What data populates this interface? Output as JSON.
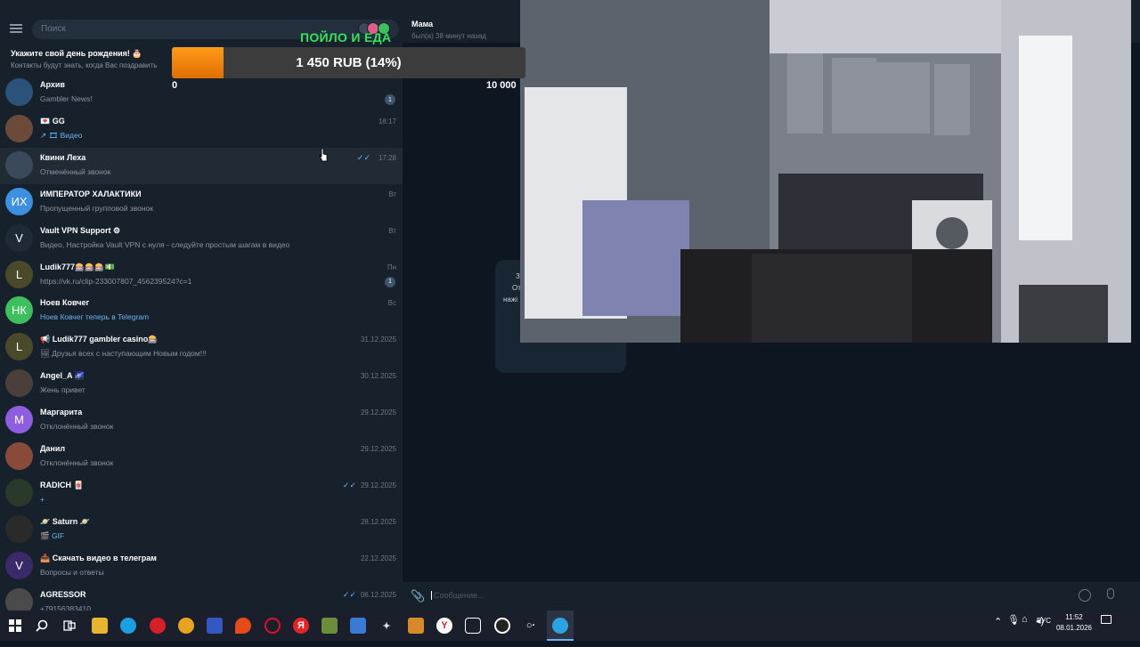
{
  "sidebar": {
    "search_placeholder": "Поиск",
    "birthday_title": "Укажите свой день рождения! 🎂",
    "birthday_sub": "Контакты будут знать, когда Вас поздравить",
    "chats": [
      {
        "name": "Архив",
        "preview": "Gambler News!",
        "time": "",
        "badge": "1",
        "avatar_text": "",
        "avatar_color": "#2b5278"
      },
      {
        "name": "💌 GG",
        "preview": "↗ 🎞 Видео",
        "time": "18:17",
        "badge": "",
        "avatar_text": "",
        "avatar_color": "#6b4a3a"
      },
      {
        "name": "Квини Леха",
        "preview": "Отменённый звонок",
        "time": "17:28",
        "badge": "",
        "avatar_text": "",
        "avatar_color": "#3a4a5a",
        "checked": true
      },
      {
        "name": "ИМПЕРАТОР ХАЛАКТИКИ",
        "preview": "Пропущенный групповой звонок",
        "time": "Вт",
        "badge": "",
        "avatar_text": "ИХ",
        "avatar_color": "#3d8fe0"
      },
      {
        "name": "Vault VPN Support ⚙",
        "preview": "Видео, Настройка Vault VPN с нуля - следуйте простым шагам в видео",
        "time": "Вт",
        "badge": "",
        "avatar_text": "V",
        "avatar_color": "#1e2a38"
      },
      {
        "name": "Ludik777🎰🎰🎰💵",
        "preview": "https://vk.ru/clip-233007807_456239524?c=1",
        "time": "Пн",
        "badge": "1",
        "avatar_text": "L",
        "avatar_color": "#4a4a2a"
      },
      {
        "name": "Ноев Ковчег",
        "preview": "Ноев Ковчег теперь в Telegram",
        "time": "Вс",
        "badge": "",
        "avatar_text": "НК",
        "avatar_color": "#3cbf5c"
      },
      {
        "name": "📢 Ludik777 gambler casino🎰",
        "preview": "🖼 Друзья всех с наступающим Новым годом!!!",
        "time": "31.12.2025",
        "badge": "",
        "avatar_text": "L",
        "avatar_color": "#4a4a2a"
      },
      {
        "name": "Angel_A 🌌",
        "preview": "Жень привет",
        "time": "30.12.2025",
        "badge": "",
        "avatar_text": "",
        "avatar_color": "#4a3f3a"
      },
      {
        "name": "Маргарита",
        "preview": "Отклонённый звонок",
        "time": "29.12.2025",
        "badge": "",
        "avatar_text": "М",
        "avatar_color": "#8e5de0"
      },
      {
        "name": "Данил",
        "preview": "Отклонённый звонок",
        "time": "29.12.2025",
        "badge": "",
        "avatar_text": "",
        "avatar_color": "#8a4a3a"
      },
      {
        "name": "RADICH 🀄",
        "preview": "+",
        "time": "29.12.2025",
        "badge": "",
        "avatar_text": "",
        "avatar_color": "#2a3a2a",
        "checked": true
      },
      {
        "name": "🪐 Saturn 🪐",
        "preview": "🎬 GIF",
        "time": "28.12.2025",
        "badge": "",
        "avatar_text": "",
        "avatar_color": "#2a2a2a"
      },
      {
        "name": "📥 Скачать видео в телеграм",
        "preview": "Вопросы и ответы",
        "time": "22.12.2025",
        "badge": "",
        "avatar_text": "V",
        "avatar_color": "#3a2a6a"
      },
      {
        "name": "AGRESSOR",
        "preview": "+79156383410",
        "time": "06.12.2025",
        "badge": "",
        "avatar_text": "",
        "avatar_color": "#4a4a4a",
        "checked": true
      }
    ]
  },
  "overlay": {
    "title": "ПОЙЛО И ЕДА",
    "goal_text": "1 450 RUB (14%)",
    "goal_fraction": 0.145,
    "goal_min": "0",
    "goal_max": "10 000",
    "fill_color": "#ff8c00"
  },
  "chat": {
    "peer_name": "Мама",
    "peer_status": "был(а) 38 минут назад",
    "bubble_lines": [
      "З",
      "От",
      "нажі"
    ],
    "input_placeholder": "Сообщение..."
  },
  "taskbar": {
    "lang": "РУС",
    "time": "11:52",
    "date": "08.01.2026"
  }
}
